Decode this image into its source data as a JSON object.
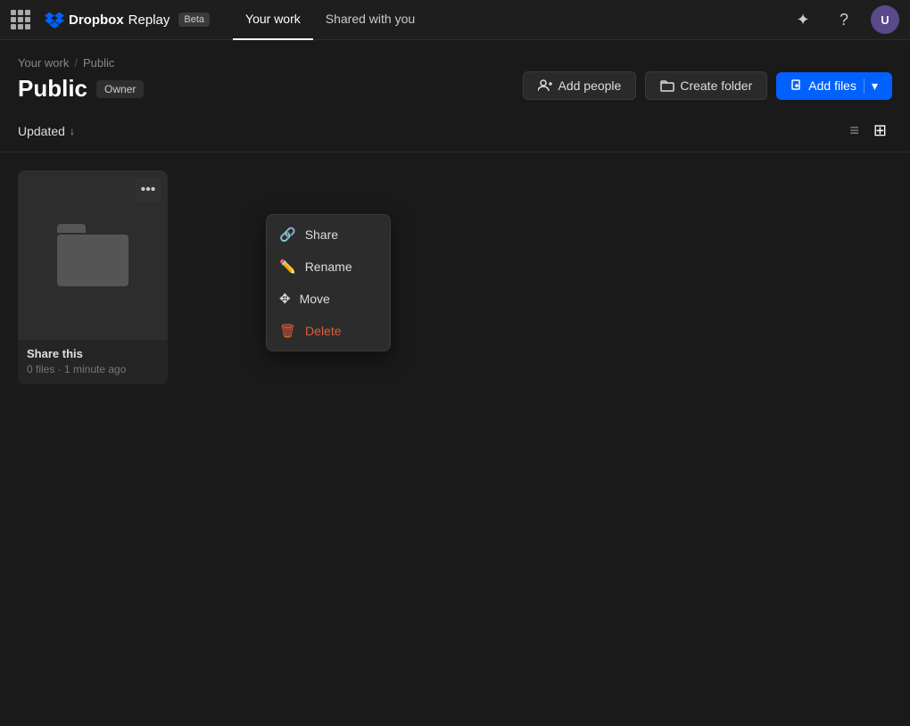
{
  "nav": {
    "app_name": "Dropbox",
    "app_sub": "Replay",
    "beta_label": "Beta",
    "links": [
      {
        "label": "Your work",
        "active": true
      },
      {
        "label": "Shared with you",
        "active": false
      }
    ],
    "help_icon": "?",
    "avatar_initials": "U"
  },
  "breadcrumb": {
    "items": [
      "Your work",
      "Public"
    ],
    "sep": "/"
  },
  "page": {
    "title": "Public",
    "owner_label": "Owner"
  },
  "actions": {
    "add_people": "Add people",
    "create_folder": "Create folder",
    "add_files": "Add files"
  },
  "sort_bar": {
    "sort_label": "Updated",
    "sort_arrow": "↓",
    "view_list_icon": "≡",
    "view_grid_icon": "⊞"
  },
  "files": [
    {
      "name": "Share this",
      "meta": "0 files · 1 minute ago"
    }
  ],
  "context_menu": {
    "items": [
      {
        "label": "Share",
        "icon": "🔗",
        "danger": false
      },
      {
        "label": "Rename",
        "icon": "✏️",
        "danger": false
      },
      {
        "label": "Move",
        "icon": "✥",
        "danger": false
      },
      {
        "label": "Delete",
        "icon": "🗑",
        "danger": true
      }
    ]
  }
}
